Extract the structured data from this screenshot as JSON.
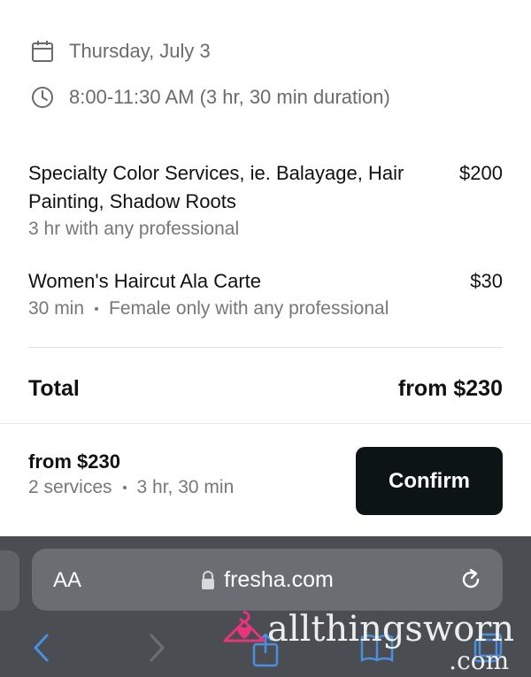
{
  "appointment": {
    "date": "Thursday, July 3",
    "time": "8:00-11:30 AM (3 hr, 30 min duration)"
  },
  "services": [
    {
      "name": "Specialty Color Services, ie. Balayage, Hair Painting, Shadow Roots",
      "price": "$200",
      "duration": "3 hr",
      "detail": "with any professional"
    },
    {
      "name": "Women's Haircut Ala Carte",
      "price": "$30",
      "duration": "30 min",
      "detail": "Female only with any professional"
    }
  ],
  "total": {
    "label": "Total",
    "value": "from $230"
  },
  "footer": {
    "price": "from $230",
    "services_count": "2 services",
    "duration": "3 hr, 30 min",
    "confirm_label": "Confirm"
  },
  "browser": {
    "text_size_label": "AA",
    "url": "fresha.com"
  },
  "watermark": {
    "text": "allthingsworn",
    "suffix": ".com"
  },
  "colors": {
    "confirm_bg": "#0d1416",
    "muted_text": "#777777",
    "browser_bg": "#4a4d52",
    "nav_accent": "#4a8fe0"
  }
}
